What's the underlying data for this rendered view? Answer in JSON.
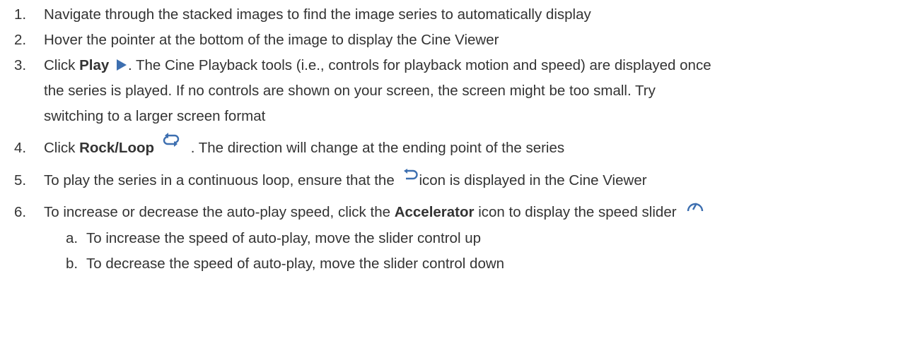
{
  "steps": [
    {
      "num": "1.",
      "text": "Navigate through the stacked images to find the image series to automatically display"
    },
    {
      "num": "2.",
      "text": "Hover the pointer at the bottom of the image to display the Cine Viewer"
    },
    {
      "num": "3.",
      "pre": "Click ",
      "bold": "Play",
      "icon": "play-icon",
      "line1": ". The Cine Playback tools (i.e., controls for playback motion and speed) are displayed once",
      "line2": "the series is played.  If no controls are shown on your screen, the screen might be too small.  Try",
      "line3": "switching to a larger screen format"
    },
    {
      "num": "4.",
      "pre": "Click ",
      "bold": "Rock/Loop",
      "icon": "rock-loop-icon",
      "post": ". The direction will change at the ending point of the series"
    },
    {
      "num": "5.",
      "pre": "To play the series in a continuous loop, ensure that the ",
      "icon": "loop-icon",
      "post": "icon is displayed in the Cine Viewer"
    },
    {
      "num": "6.",
      "pre": "To increase or decrease the auto-play speed, click the ",
      "bold": "Accelerator",
      "post": " icon to display the speed slider",
      "icon": "speedometer-icon"
    }
  ],
  "substeps": [
    {
      "num": "a.",
      "text": "To increase the speed of auto-play, move the slider control up"
    },
    {
      "num": "b.",
      "text": "To decrease the speed of auto-play, move the slider control down"
    }
  ],
  "colors": {
    "text": "#333333",
    "icon_blue": "#3d6fb0"
  }
}
